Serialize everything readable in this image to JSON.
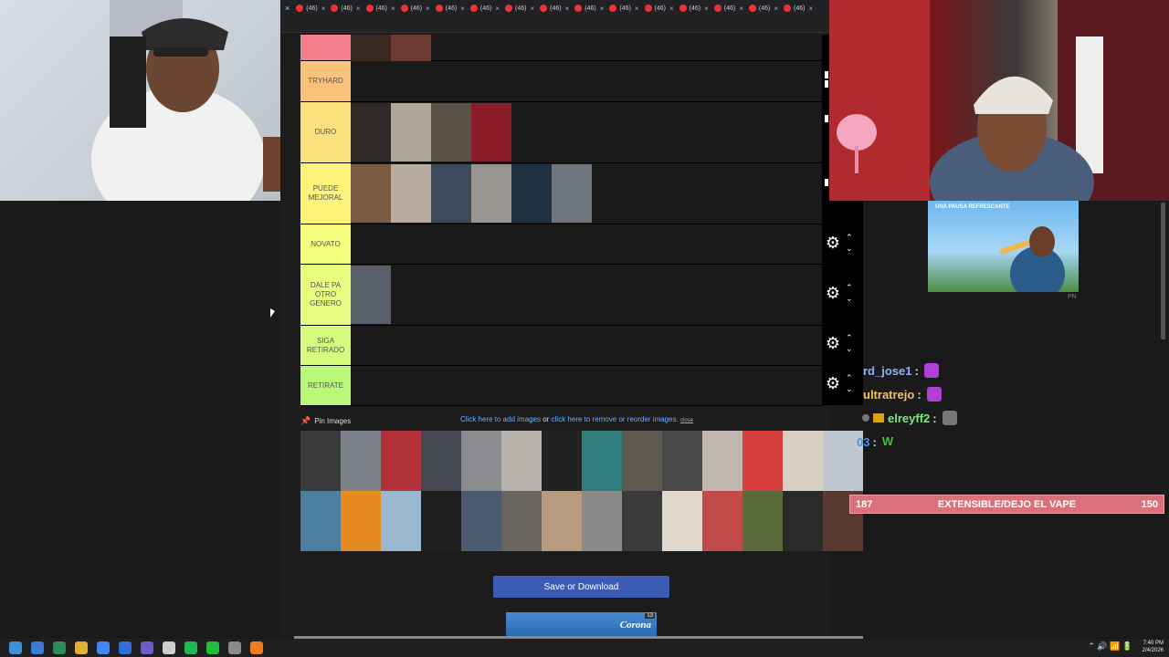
{
  "tabs": {
    "first_close": "×",
    "items": [
      {
        "label": "(46)"
      },
      {
        "label": "(46)"
      },
      {
        "label": "(46)"
      },
      {
        "label": "(46)"
      },
      {
        "label": "(46)"
      },
      {
        "label": "(46)"
      },
      {
        "label": "(46)"
      },
      {
        "label": "(46)"
      },
      {
        "label": "(46)"
      },
      {
        "label": "(46)"
      },
      {
        "label": "(46)"
      },
      {
        "label": "(46)"
      },
      {
        "label": "(46)"
      },
      {
        "label": "(46)"
      },
      {
        "label": "(46)"
      }
    ],
    "close_glyph": "×"
  },
  "tiers": [
    {
      "label": "",
      "color": "#f47f8a",
      "thumbs": [
        "#3a2a24",
        "#6b3a30"
      ]
    },
    {
      "label": "TRYHARD",
      "color": "#f9c17a",
      "thumbs": []
    },
    {
      "label": "DURO",
      "color": "#fbe07e",
      "thumbs": [
        "#2e2a28",
        "#b1a69a",
        "#5a5046",
        "#8a1c2a"
      ]
    },
    {
      "label": "PUEDE MEJORAL",
      "color": "#fdf27a",
      "thumbs": [
        "#7a5a40",
        "#b8aca0",
        "#3e4a5a",
        "#9a9590",
        "#1f3040",
        "#6e757c"
      ]
    },
    {
      "label": "NOVATO",
      "color": "#f5fd7c",
      "thumbs": []
    },
    {
      "label": "DALE PA OTRO GENERO",
      "color": "#e8fc80",
      "thumbs": [
        "#58606a"
      ]
    },
    {
      "label": "SIGA RETIRADO",
      "color": "#d4fb7d",
      "thumbs": []
    },
    {
      "label": "RETIRATE",
      "color": "#b8f97a",
      "thumbs": []
    }
  ],
  "controls": {
    "gear": "⚙",
    "up": "⌃",
    "down": "⌄"
  },
  "pin": {
    "icon": "📌",
    "label": "Pin Images",
    "add_link": "Click here to add images",
    "or_text": "or",
    "reorder_link": "click here to remove or reorder images.",
    "close": "close"
  },
  "pool_colors": [
    "#3a3b3c",
    "#7c8088",
    "#b3323a",
    "#454850",
    "#8a8c90",
    "#b7b2ac",
    "#222",
    "#2f7d7d",
    "#5e5a52",
    "#4a4a48",
    "#c0b8b0",
    "#d84040",
    "#d8d0c4",
    "#c0c8d0",
    "#4b7fa0",
    "#e58a20",
    "#9ab8d0",
    "#1f1f1f",
    "#4c5c70",
    "#6a6460",
    "#b89a80",
    "#8a8a88",
    "#3a3a3a",
    "#e0d8cc",
    "#c24a4a",
    "#5a6a3a",
    "#2a2a2a",
    "#5a3a30"
  ],
  "save_button": "Save or Download",
  "ad_banner": {
    "brand": "Corona",
    "badge": "13"
  },
  "ad_card": {
    "caption": "UNA PAUSA REFRESCANTE",
    "pn": "PN"
  },
  "chat": [
    {
      "user": "rd_jose1",
      "sep": ":",
      "user_color": "#8ab4f8",
      "emote_color": "#b23fd8"
    },
    {
      "user": "ultratrejo",
      "sep": ":",
      "user_color": "#f4c06a",
      "emote_color": "#b23fd8"
    },
    {
      "user": "elreyff2",
      "sep": ":",
      "user_color": "#7ee67e",
      "emote_color": "#777"
    },
    {
      "user": "03",
      "sep": ":",
      "user_color": "#4a90e2",
      "emote_text": "W",
      "emote_color": "#3ec53e"
    }
  ],
  "goal": {
    "left": "187",
    "title": "EXTENSIBLE/DEJO EL VAPE",
    "right": "150"
  },
  "taskbar": {
    "icons": [
      "#3a7bd5",
      "#2e8b57",
      "#e0b030",
      "#4285f4",
      "#2f6fdd",
      "#6d5acd",
      "#cfcfcf",
      "#1db954",
      "#1fbf3a",
      "#8a8a8a",
      "#f07a20"
    ],
    "tray": "⌃ 🔊 📶 🔋",
    "time": "7:40 PM",
    "date": "2/4/2026"
  }
}
